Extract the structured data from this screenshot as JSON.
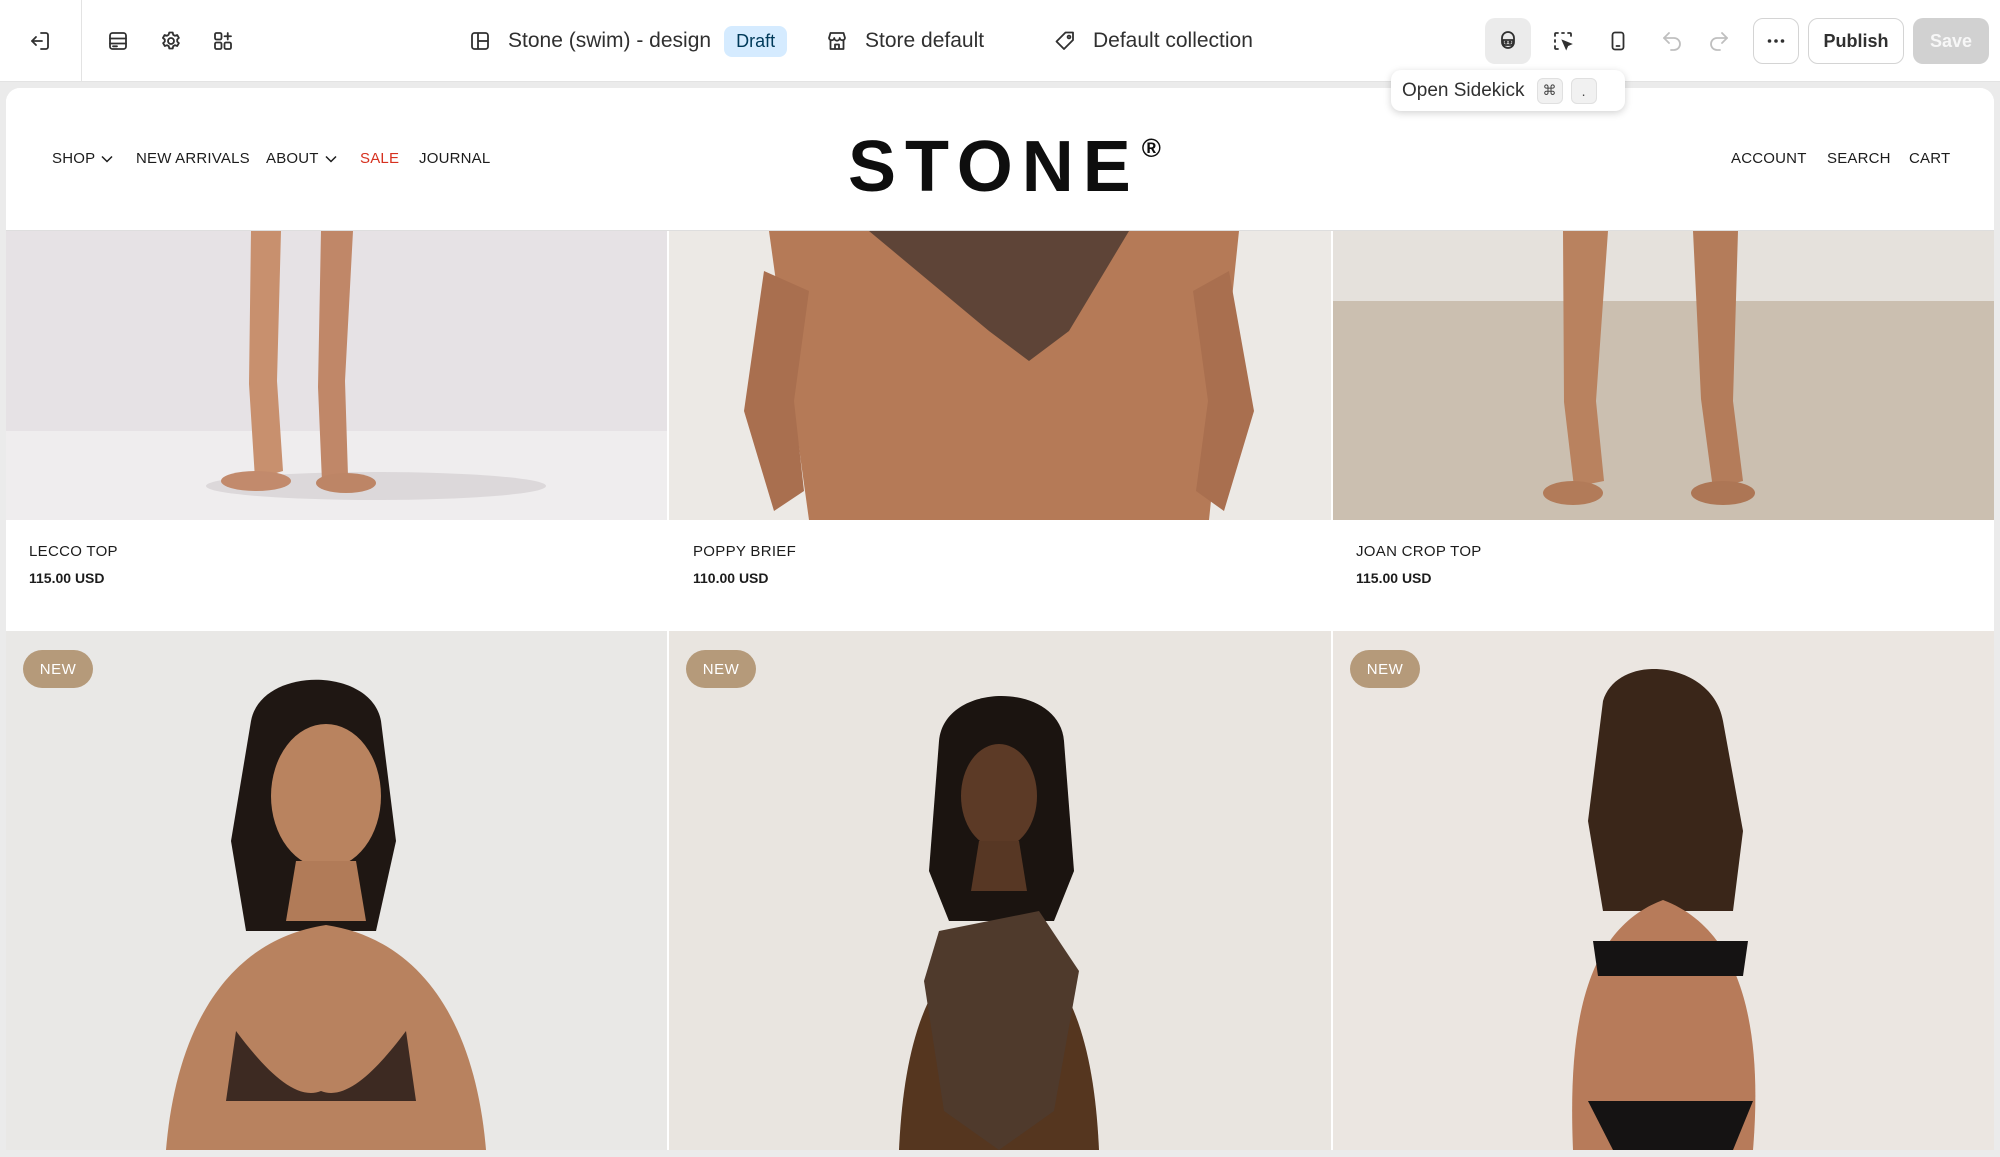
{
  "toolbar": {
    "theme_name": "Stone (swim) - design",
    "theme_status": "Draft",
    "store": "Store default",
    "collection": "Default collection",
    "publish_label": "Publish",
    "save_label": "Save",
    "icons": [
      "exit-icon",
      "sections-icon",
      "settings-icon",
      "apps-icon",
      "theme-icon",
      "store-icon",
      "tag-icon",
      "sidekick-icon",
      "inspector-icon",
      "mobile-icon",
      "undo-icon",
      "redo-icon",
      "more-icon"
    ]
  },
  "tooltip": {
    "label": "Open Sidekick",
    "keys": [
      "⌘",
      "."
    ]
  },
  "site": {
    "logo": "STONE",
    "logo_mark": "®",
    "nav_left": [
      "SHOP",
      "NEW ARRIVALS",
      "ABOUT",
      "SALE",
      "JOURNAL"
    ],
    "nav_right": [
      "ACCOUNT",
      "SEARCH",
      "CART"
    ],
    "sale_color": "#d6311f"
  },
  "products": [
    {
      "name": "LECCO TOP",
      "price": "115.00 USD"
    },
    {
      "name": "POPPY BRIEF",
      "price": "110.00 USD"
    },
    {
      "name": "JOAN CROP TOP",
      "price": "115.00 USD"
    }
  ],
  "badges": [
    "NEW",
    "NEW",
    "NEW"
  ],
  "colors": {
    "badge": "#b59a7a",
    "draft_badge_bg": "#d5ebff"
  }
}
